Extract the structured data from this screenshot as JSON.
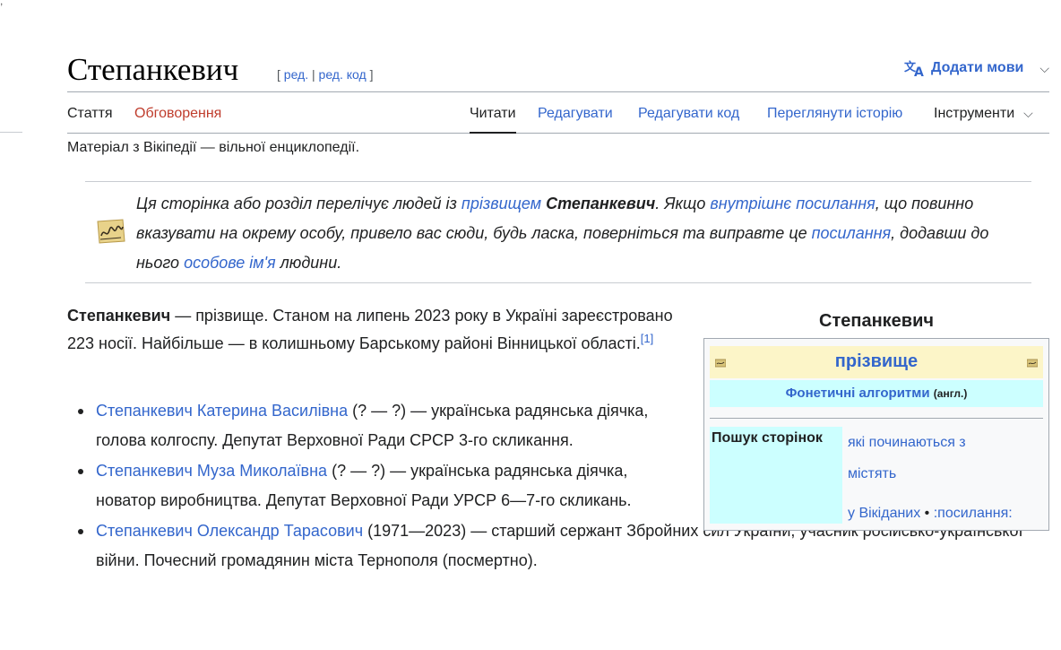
{
  "header": {
    "title": "Степанкевич",
    "edit_open": "[ ",
    "edit": "ред.",
    "edit_sep": " | ",
    "edit_code": "ред. код",
    "edit_close": " ]",
    "add_languages": "Додати мови"
  },
  "tabs": {
    "article": "Стаття",
    "talk": "Обговорення",
    "read": "Читати",
    "edit": "Редагувати",
    "edit_code": "Редагувати код",
    "history": "Переглянути історію",
    "tools": "Інструменти"
  },
  "tagline": "Матеріал з Вікіпедії — вільної енциклопедії.",
  "hatnote": {
    "p1": "Ця сторінка або розділ перелічує людей із ",
    "link1": "прізвищем",
    "p2": " ",
    "name": "Степанкевич",
    "p3": ". Якщо ",
    "link2": "внутрішнє посилання",
    "p4": ", що повинно вказувати на окрему особу, привело вас сюди, будь ласка, поверніться та виправте це ",
    "link3": "посилання",
    "p5": ", додавши до нього ",
    "link4": "особове ім'я",
    "p6": " людини."
  },
  "intro": {
    "name": "Степанкевич",
    "text": " — прізвище. Станом на липень 2023 року в Україні зареєстровано 223 носії. Найбільше — в колишньому Барському районі Вінницької області.",
    "ref": "[1]"
  },
  "people": [
    {
      "name": "Степанкевич Катерина Василівна",
      "desc": " (? — ?) — українська радянська діячка, голова колгоспу. Депутат Верховної Ради СРСР 3-го скликання."
    },
    {
      "name": "Степанкевич Муза Миколаївна",
      "desc": " (? — ?) — українська радянська діячка, новатор виробництва. Депутат Верховної Ради УРСР 6—7-го скликань."
    },
    {
      "name": "Степанкевич Олександр Тарасович",
      "desc": " (1971—2023) — старший сержант Збройних сил України, учасник російсько-української війни. Почесний громадянин міста Тернополя (посмертно)."
    }
  ],
  "infobox": {
    "title": "Степанкевич",
    "header": "прізвище",
    "phonetic": "Фонетичні алгоритми",
    "phonetic_lang": "(англ.)",
    "search_label": "Пошук сторінок",
    "starts_with": "які починаються з",
    "contain": "містять",
    "wikidata": "у Вікіданих",
    "bullet": " • ",
    "links": ":посилання:"
  }
}
